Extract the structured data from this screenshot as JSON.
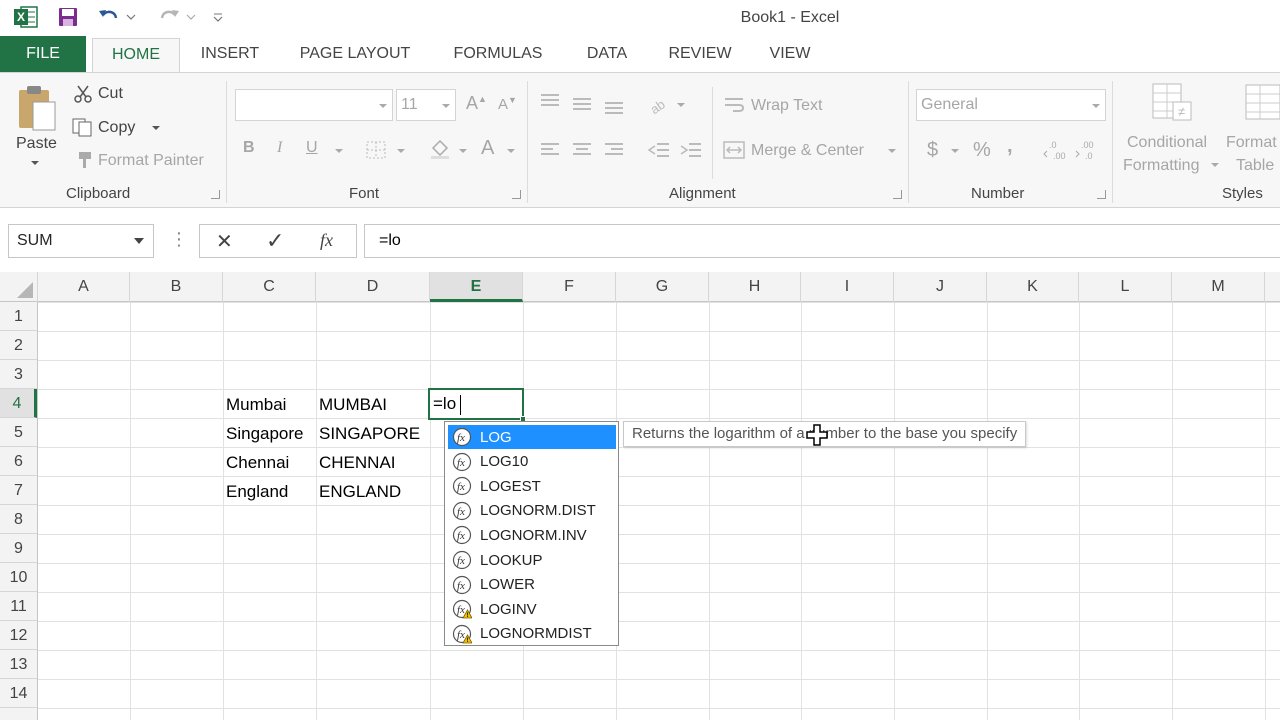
{
  "app": {
    "title": "Book1 - Excel",
    "icons": {
      "app": "excel-logo",
      "save": "save-icon",
      "undo": "undo-icon",
      "redo": "redo-icon",
      "customize": "customize-qat-icon"
    }
  },
  "tabs": [
    "FILE",
    "HOME",
    "INSERT",
    "PAGE LAYOUT",
    "FORMULAS",
    "DATA",
    "REVIEW",
    "VIEW"
  ],
  "active_tab": "HOME",
  "ribbon": {
    "clipboard": {
      "label": "Clipboard",
      "paste": "Paste",
      "cut": "Cut",
      "copy": "Copy",
      "format_painter": "Format Painter"
    },
    "font": {
      "label": "Font",
      "font_name": "",
      "font_size": "11",
      "bold": "B",
      "italic": "I",
      "underline": "U",
      "font_color": "A"
    },
    "alignment": {
      "label": "Alignment",
      "wrap_text": "Wrap Text",
      "merge_center": "Merge & Center"
    },
    "number": {
      "label": "Number",
      "format": "General",
      "currency": "$",
      "percent": "%",
      "comma": ","
    },
    "styles": {
      "label": "Styles",
      "conditional_formatting_1": "Conditional",
      "conditional_formatting_2": "Formatting",
      "format_as_table_1": "Format",
      "format_as_table_2": "Table"
    }
  },
  "formula_bar": {
    "name_box": "SUM",
    "formula": "=lo",
    "cancel": "✕",
    "enter": "✓",
    "fx": "fx"
  },
  "columns": [
    "A",
    "B",
    "C",
    "D",
    "E",
    "F",
    "G",
    "H",
    "I",
    "J",
    "K",
    "L",
    "M"
  ],
  "selected_column": "E",
  "rows": [
    "1",
    "2",
    "3",
    "4",
    "5",
    "6",
    "7",
    "8",
    "9",
    "10",
    "11",
    "12",
    "13",
    "14"
  ],
  "selected_row": "4",
  "cells": {
    "C4": "Mumbai",
    "D4": "MUMBAI",
    "C5": "Singapore",
    "D5": "SINGAPORE",
    "C6": "Chennai",
    "D6": "CHENNAI",
    "C7": "England",
    "D7": "ENGLAND",
    "E4": "=lo"
  },
  "autocomplete": {
    "items": [
      {
        "label": "LOG",
        "selected": true,
        "compat": false
      },
      {
        "label": "LOG10",
        "selected": false,
        "compat": false
      },
      {
        "label": "LOGEST",
        "selected": false,
        "compat": false
      },
      {
        "label": "LOGNORM.DIST",
        "selected": false,
        "compat": false
      },
      {
        "label": "LOGNORM.INV",
        "selected": false,
        "compat": false
      },
      {
        "label": "LOOKUP",
        "selected": false,
        "compat": false
      },
      {
        "label": "LOWER",
        "selected": false,
        "compat": false
      },
      {
        "label": "LOGINV",
        "selected": false,
        "compat": true
      },
      {
        "label": "LOGNORMDIST",
        "selected": false,
        "compat": true
      }
    ],
    "tooltip": "Returns the logarithm of a number to the base you specify"
  },
  "colors": {
    "accent": "#217346",
    "selection": "#1e90ff"
  }
}
